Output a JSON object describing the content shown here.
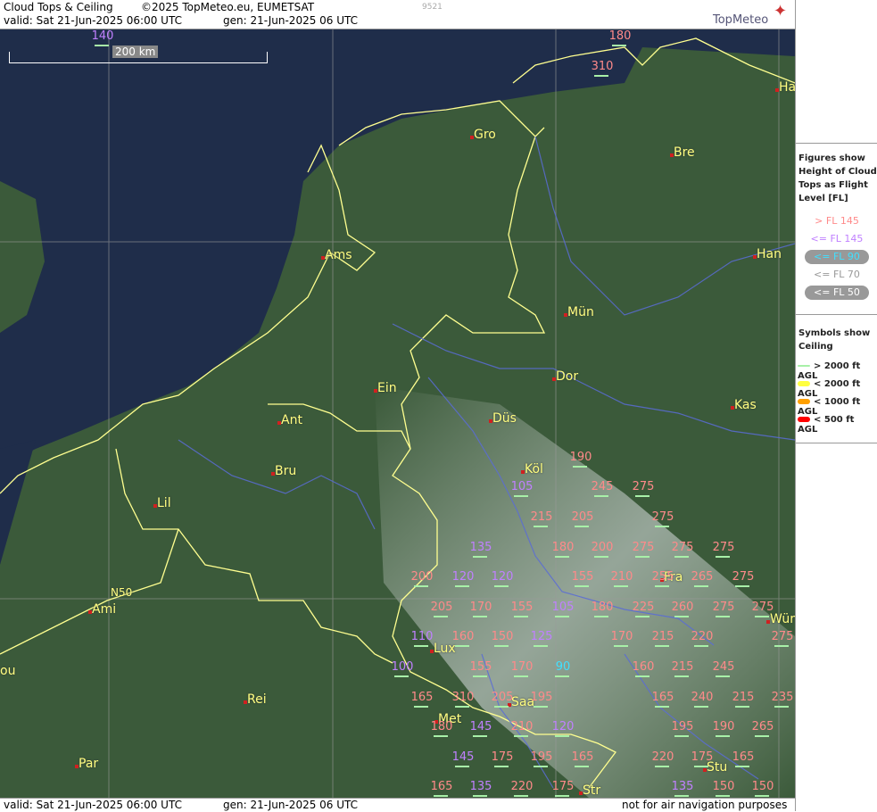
{
  "header": {
    "title": "Cloud Tops & Ceiling",
    "copyright": "©2025 TopMeteo.eu, EUMETSAT",
    "valid": "valid:  Sat  21-Jun-2025  06:00 UTC",
    "generated": "gen:  21-Jun-2025 06 UTC",
    "code": "9521",
    "brand": "TopMeteo"
  },
  "footer": {
    "valid": "valid:  Sat  21-Jun-2025  06:00 UTC",
    "generated": "gen:  21-Jun-2025 06 UTC",
    "disclaimer": "not for air navigation purposes"
  },
  "scale_label": "200 km",
  "grid_label": "N50",
  "legend": {
    "heading": "Figures show Height of Cloud Tops as Flight Level  [FL]",
    "items": [
      "> FL 145",
      "<= FL 145",
      "<= FL 90",
      "<= FL 70",
      "<= FL 50"
    ],
    "colors": [
      "#ff8a8a",
      "#c080ff",
      "#40e0ff",
      "#aaaaaa",
      "#ffffff"
    ],
    "symbols_heading": "Symbols show Ceiling",
    "symbols": [
      "> 2000 ft AGL",
      "< 2000 ft AGL",
      "< 1000 ft AGL",
      "< 500 ft AGL"
    ],
    "symbol_colors": [
      "#a8f0a8",
      "#ffff40",
      "#ffa000",
      "#ff0000"
    ]
  },
  "cities": [
    "Gro",
    "Bre",
    "Ams",
    "Han",
    "Mün",
    "Ein",
    "Dor",
    "Ant",
    "Düs",
    "Kas",
    "Bru",
    "Köl",
    "Lil",
    "Fra",
    "Ami",
    "Lux",
    "Wür",
    "Met",
    "Saa",
    "Rei",
    "Par",
    "Stu",
    "Str",
    "Ha",
    "ou"
  ],
  "flight_levels": [
    "140",
    "180",
    "310",
    "190",
    "105",
    "245",
    "275",
    "215",
    "205",
    "275",
    "135",
    "180",
    "200",
    "275",
    "275",
    "275",
    "200",
    "120",
    "120",
    "155",
    "210",
    "255",
    "265",
    "275",
    "205",
    "170",
    "155",
    "105",
    "180",
    "225",
    "260",
    "275",
    "275",
    "110",
    "160",
    "150",
    "125",
    "170",
    "215",
    "220",
    "275",
    "100",
    "155",
    "170",
    "90",
    "160",
    "215",
    "245",
    "165",
    "310",
    "205",
    "195",
    "165",
    "240",
    "215",
    "235",
    "180",
    "145",
    "210",
    "120",
    "195",
    "190",
    "265",
    "145",
    "175",
    "195",
    "165",
    "220",
    "175",
    "165",
    "165",
    "135",
    "220",
    "175",
    "135",
    "150",
    "150"
  ]
}
